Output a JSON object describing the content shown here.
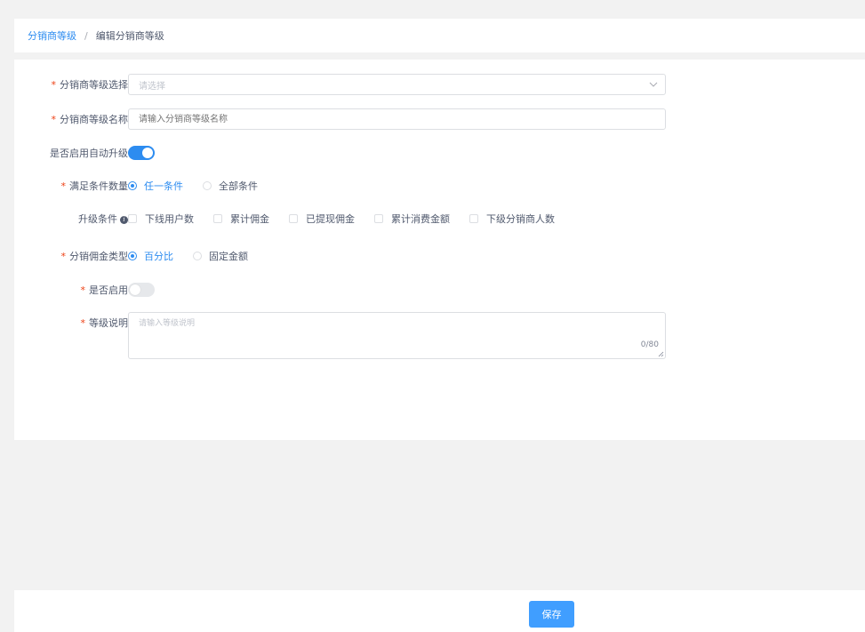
{
  "breadcrumb": {
    "parent": "分销商等级",
    "separator": "/",
    "current": "编辑分销商等级"
  },
  "form": {
    "level_select": {
      "label": "分销商等级选择",
      "placeholder": "请选择",
      "required": true
    },
    "level_name": {
      "label": "分销商等级名称",
      "placeholder": "请输入分销商等级名称",
      "required": true
    },
    "auto_upgrade": {
      "label": "是否启用自动升级",
      "enabled": true
    },
    "condition_count": {
      "label": "满足条件数量",
      "required": true,
      "options": [
        "任一条件",
        "全部条件"
      ],
      "selected": "任一条件"
    },
    "upgrade_conditions": {
      "label": "升级条件",
      "options": [
        "下线用户数",
        "累计佣金",
        "已提现佣金",
        "累计消费金额",
        "下级分销商人数"
      ]
    },
    "commission_type": {
      "label": "分销佣金类型",
      "required": true,
      "options": [
        "百分比",
        "固定金额"
      ],
      "selected": "百分比"
    },
    "enabled": {
      "label": "是否启用",
      "required": true,
      "enabled": false
    },
    "description": {
      "label": "等级说明",
      "required": true,
      "placeholder": "请输入等级说明",
      "counter": "0/80"
    }
  },
  "footer": {
    "save_label": "保存"
  },
  "colors": {
    "accent": "#2d8cf0",
    "button": "#409eff",
    "required": "#ed4014"
  }
}
